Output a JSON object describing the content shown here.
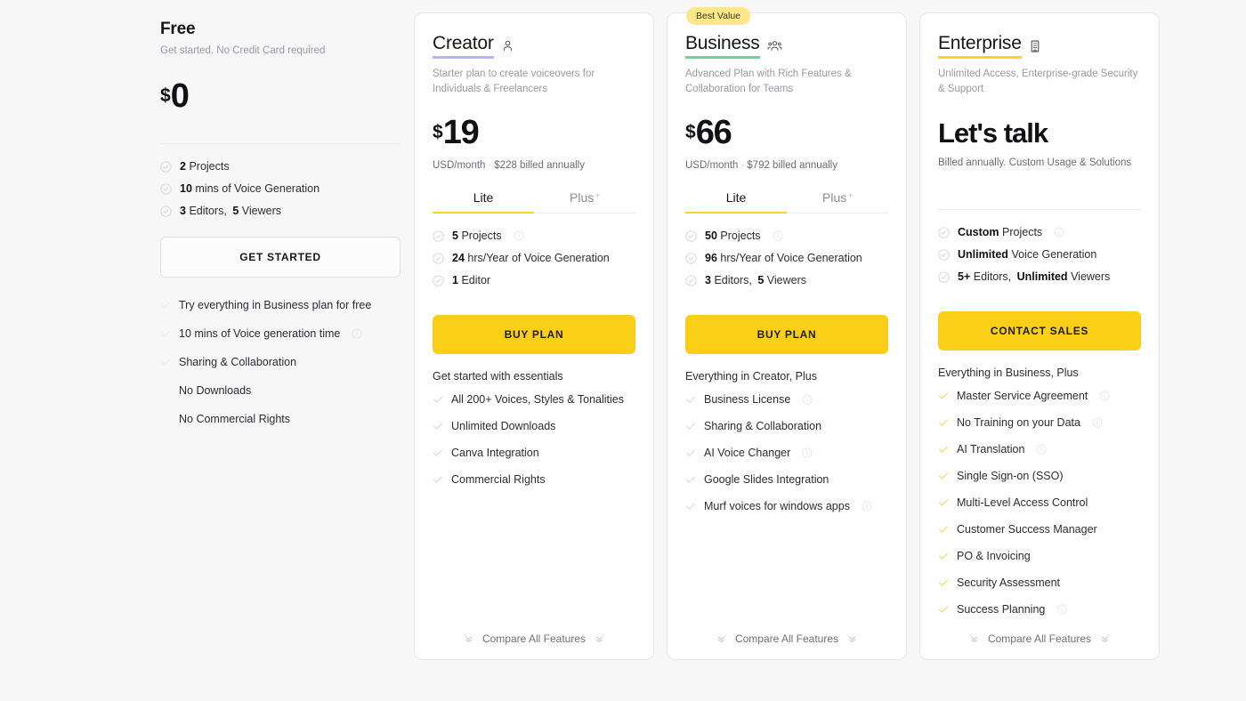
{
  "badge": {
    "best_value": "Best Value"
  },
  "free": {
    "title": "Free",
    "subtitle": "Get started. No Credit Card required",
    "currency": "$",
    "amount": "0",
    "specs": [
      {
        "value": "2",
        "label": "Projects"
      },
      {
        "value": "10",
        "label": "mins of Voice Generation"
      },
      {
        "value": "3",
        "label": "Editors,",
        "value2": "5",
        "label2": "Viewers"
      }
    ],
    "cta": "GET STARTED",
    "benefits": [
      {
        "label": "Try everything in Business plan for free",
        "info": false
      },
      {
        "label": "10 mins of Voice generation time",
        "info": true
      },
      {
        "label": "Sharing & Collaboration",
        "info": false
      },
      {
        "label": "No Downloads",
        "info": false,
        "nocheck": true
      },
      {
        "label": "No Commercial Rights",
        "info": false,
        "nocheck": true
      }
    ]
  },
  "creator": {
    "title": "Creator",
    "icon": "single-person-icon",
    "underline_color": "#b9b5f0",
    "subtitle": "Starter plan to create voiceovers for Individuals & Freelancers",
    "currency": "$",
    "amount": "19",
    "billing_period": "USD/month",
    "billing_annual": "$228 billed annually",
    "tabs": [
      {
        "label": "Lite",
        "active": true
      },
      {
        "label": "Plus",
        "active": false,
        "sup": "+"
      }
    ],
    "specs": [
      {
        "value": "5",
        "label": "Projects",
        "info": true
      },
      {
        "value": "24",
        "label": "hrs/Year of Voice Generation",
        "info": false
      },
      {
        "value": "1",
        "label": "Editor",
        "info": false
      }
    ],
    "cta": "BUY PLAN",
    "benefit_head": "Get started with essentials",
    "benefits": [
      {
        "label": "All 200+ Voices, Styles & Tonalities",
        "info": false
      },
      {
        "label": "Unlimited Downloads",
        "info": false
      },
      {
        "label": "Canva Integration",
        "info": false
      },
      {
        "label": "Commercial Rights",
        "info": false
      }
    ],
    "compare": "Compare All Features"
  },
  "business": {
    "title": "Business",
    "icon": "group-people-icon",
    "underline_color": "#6fd49a",
    "subtitle": "Advanced Plan with Rich Features & Collaboration for Teams",
    "currency": "$",
    "amount": "66",
    "billing_period": "USD/month",
    "billing_annual": "$792 billed annually",
    "tabs": [
      {
        "label": "Lite",
        "active": true
      },
      {
        "label": "Plus",
        "active": false,
        "sup": "+"
      }
    ],
    "specs": [
      {
        "value": "50",
        "label": "Projects",
        "info": true
      },
      {
        "value": "96",
        "label": "hrs/Year of Voice Generation",
        "info": false
      },
      {
        "value": "3",
        "label": "Editors,",
        "value2": "5",
        "label2": "Viewers",
        "info": false
      }
    ],
    "cta": "BUY PLAN",
    "benefit_head": "Everything in Creator, Plus",
    "benefits": [
      {
        "label": "Business License",
        "info": true
      },
      {
        "label": "Sharing & Collaboration",
        "info": false
      },
      {
        "label": "AI Voice Changer",
        "info": true
      },
      {
        "label": "Google Slides Integration",
        "info": false
      },
      {
        "label": "Murf voices for windows apps",
        "info": true
      }
    ],
    "compare": "Compare All Features"
  },
  "enterprise": {
    "title": "Enterprise",
    "icon": "building-icon",
    "underline_color": "#fbd32b",
    "subtitle": "Unlimited Access, Enterprise-grade Security & Support",
    "price_text": "Let's talk",
    "billing": "Billed annually. Custom Usage & Solutions",
    "specs": [
      {
        "value": "Custom",
        "label": "Projects",
        "info": true
      },
      {
        "value": "Unlimited",
        "label": "Voice Generation",
        "info": false
      },
      {
        "value": "5+",
        "label": "Editors,",
        "value2": "Unlimited",
        "label2": "Viewers",
        "info": false
      }
    ],
    "cta": "CONTACT SALES",
    "benefit_head": "Everything in Business, Plus",
    "benefits": [
      {
        "label": "Master Service Agreement",
        "info": true
      },
      {
        "label": "No Training on your Data",
        "info": true
      },
      {
        "label": "AI Translation",
        "info": true
      },
      {
        "label": "Single Sign-on (SSO)",
        "info": false
      },
      {
        "label": "Multi-Level Access Control",
        "info": false
      },
      {
        "label": "Customer Success Manager",
        "info": false
      },
      {
        "label": "PO & Invoicing",
        "info": false
      },
      {
        "label": "Security Assessment",
        "info": false
      },
      {
        "label": "Success Planning",
        "info": true
      }
    ],
    "compare": "Compare All Features"
  },
  "colors": {
    "accent_yellow": "#fbcf17",
    "badge_yellow": "#fbe88a",
    "creator_underline": "#b9b5f0",
    "business_underline": "#6fd49a",
    "enterprise_underline": "#fbd32b",
    "page_bg": "#f7f7f8"
  }
}
